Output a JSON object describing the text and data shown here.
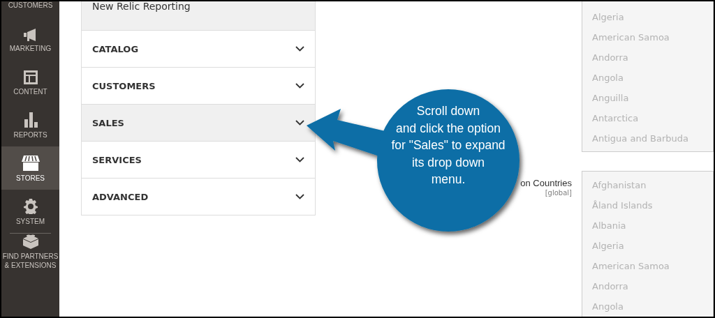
{
  "sidebar": {
    "items": [
      {
        "label": "CUSTOMERS",
        "selected": false
      },
      {
        "label": "MARKETING",
        "selected": false
      },
      {
        "label": "CONTENT",
        "selected": false
      },
      {
        "label": "REPORTS",
        "selected": false
      },
      {
        "label": "STORES",
        "selected": true
      },
      {
        "label": "SYSTEM",
        "selected": false
      },
      {
        "label": "FIND PARTNERS & EXTENSIONS",
        "selected": false
      }
    ]
  },
  "accordion": {
    "header": "New Relic Reporting",
    "sections": [
      {
        "label": "CATALOG",
        "selected": false
      },
      {
        "label": "CUSTOMERS",
        "selected": false
      },
      {
        "label": "SALES",
        "selected": true
      },
      {
        "label": "SERVICES",
        "selected": false
      },
      {
        "label": "ADVANCED",
        "selected": false
      }
    ]
  },
  "field": {
    "label": "on Countries",
    "scope": "[global]"
  },
  "lists": [
    {
      "options": [
        "Algeria",
        "American Samoa",
        "Andorra",
        "Angola",
        "Anguilla",
        "Antarctica",
        "Antigua and Barbuda"
      ]
    },
    {
      "options": [
        "Afghanistan",
        "Åland Islands",
        "Albania",
        "Algeria",
        "American Samoa",
        "Andorra",
        "Angola"
      ]
    }
  ],
  "callout": {
    "text": "Scroll down\nand click the option\nfor \"Sales\" to expand\nits drop down\nmenu."
  }
}
